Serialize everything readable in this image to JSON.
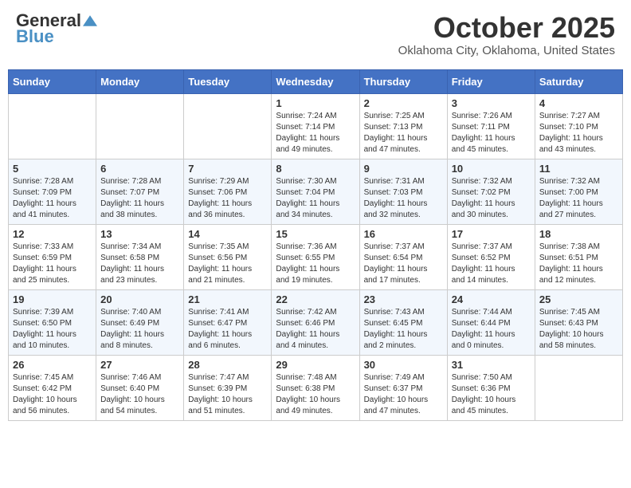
{
  "header": {
    "logo": {
      "general": "General",
      "blue": "Blue"
    },
    "title": "October 2025",
    "location": "Oklahoma City, Oklahoma, United States"
  },
  "calendar": {
    "headers": [
      "Sunday",
      "Monday",
      "Tuesday",
      "Wednesday",
      "Thursday",
      "Friday",
      "Saturday"
    ],
    "rows": [
      [
        {
          "day": "",
          "info": ""
        },
        {
          "day": "",
          "info": ""
        },
        {
          "day": "",
          "info": ""
        },
        {
          "day": "1",
          "info": "Sunrise: 7:24 AM\nSunset: 7:14 PM\nDaylight: 11 hours\nand 49 minutes."
        },
        {
          "day": "2",
          "info": "Sunrise: 7:25 AM\nSunset: 7:13 PM\nDaylight: 11 hours\nand 47 minutes."
        },
        {
          "day": "3",
          "info": "Sunrise: 7:26 AM\nSunset: 7:11 PM\nDaylight: 11 hours\nand 45 minutes."
        },
        {
          "day": "4",
          "info": "Sunrise: 7:27 AM\nSunset: 7:10 PM\nDaylight: 11 hours\nand 43 minutes."
        }
      ],
      [
        {
          "day": "5",
          "info": "Sunrise: 7:28 AM\nSunset: 7:09 PM\nDaylight: 11 hours\nand 41 minutes."
        },
        {
          "day": "6",
          "info": "Sunrise: 7:28 AM\nSunset: 7:07 PM\nDaylight: 11 hours\nand 38 minutes."
        },
        {
          "day": "7",
          "info": "Sunrise: 7:29 AM\nSunset: 7:06 PM\nDaylight: 11 hours\nand 36 minutes."
        },
        {
          "day": "8",
          "info": "Sunrise: 7:30 AM\nSunset: 7:04 PM\nDaylight: 11 hours\nand 34 minutes."
        },
        {
          "day": "9",
          "info": "Sunrise: 7:31 AM\nSunset: 7:03 PM\nDaylight: 11 hours\nand 32 minutes."
        },
        {
          "day": "10",
          "info": "Sunrise: 7:32 AM\nSunset: 7:02 PM\nDaylight: 11 hours\nand 30 minutes."
        },
        {
          "day": "11",
          "info": "Sunrise: 7:32 AM\nSunset: 7:00 PM\nDaylight: 11 hours\nand 27 minutes."
        }
      ],
      [
        {
          "day": "12",
          "info": "Sunrise: 7:33 AM\nSunset: 6:59 PM\nDaylight: 11 hours\nand 25 minutes."
        },
        {
          "day": "13",
          "info": "Sunrise: 7:34 AM\nSunset: 6:58 PM\nDaylight: 11 hours\nand 23 minutes."
        },
        {
          "day": "14",
          "info": "Sunrise: 7:35 AM\nSunset: 6:56 PM\nDaylight: 11 hours\nand 21 minutes."
        },
        {
          "day": "15",
          "info": "Sunrise: 7:36 AM\nSunset: 6:55 PM\nDaylight: 11 hours\nand 19 minutes."
        },
        {
          "day": "16",
          "info": "Sunrise: 7:37 AM\nSunset: 6:54 PM\nDaylight: 11 hours\nand 17 minutes."
        },
        {
          "day": "17",
          "info": "Sunrise: 7:37 AM\nSunset: 6:52 PM\nDaylight: 11 hours\nand 14 minutes."
        },
        {
          "day": "18",
          "info": "Sunrise: 7:38 AM\nSunset: 6:51 PM\nDaylight: 11 hours\nand 12 minutes."
        }
      ],
      [
        {
          "day": "19",
          "info": "Sunrise: 7:39 AM\nSunset: 6:50 PM\nDaylight: 11 hours\nand 10 minutes."
        },
        {
          "day": "20",
          "info": "Sunrise: 7:40 AM\nSunset: 6:49 PM\nDaylight: 11 hours\nand 8 minutes."
        },
        {
          "day": "21",
          "info": "Sunrise: 7:41 AM\nSunset: 6:47 PM\nDaylight: 11 hours\nand 6 minutes."
        },
        {
          "day": "22",
          "info": "Sunrise: 7:42 AM\nSunset: 6:46 PM\nDaylight: 11 hours\nand 4 minutes."
        },
        {
          "day": "23",
          "info": "Sunrise: 7:43 AM\nSunset: 6:45 PM\nDaylight: 11 hours\nand 2 minutes."
        },
        {
          "day": "24",
          "info": "Sunrise: 7:44 AM\nSunset: 6:44 PM\nDaylight: 11 hours\nand 0 minutes."
        },
        {
          "day": "25",
          "info": "Sunrise: 7:45 AM\nSunset: 6:43 PM\nDaylight: 10 hours\nand 58 minutes."
        }
      ],
      [
        {
          "day": "26",
          "info": "Sunrise: 7:45 AM\nSunset: 6:42 PM\nDaylight: 10 hours\nand 56 minutes."
        },
        {
          "day": "27",
          "info": "Sunrise: 7:46 AM\nSunset: 6:40 PM\nDaylight: 10 hours\nand 54 minutes."
        },
        {
          "day": "28",
          "info": "Sunrise: 7:47 AM\nSunset: 6:39 PM\nDaylight: 10 hours\nand 51 minutes."
        },
        {
          "day": "29",
          "info": "Sunrise: 7:48 AM\nSunset: 6:38 PM\nDaylight: 10 hours\nand 49 minutes."
        },
        {
          "day": "30",
          "info": "Sunrise: 7:49 AM\nSunset: 6:37 PM\nDaylight: 10 hours\nand 47 minutes."
        },
        {
          "day": "31",
          "info": "Sunrise: 7:50 AM\nSunset: 6:36 PM\nDaylight: 10 hours\nand 45 minutes."
        },
        {
          "day": "",
          "info": ""
        }
      ]
    ]
  }
}
